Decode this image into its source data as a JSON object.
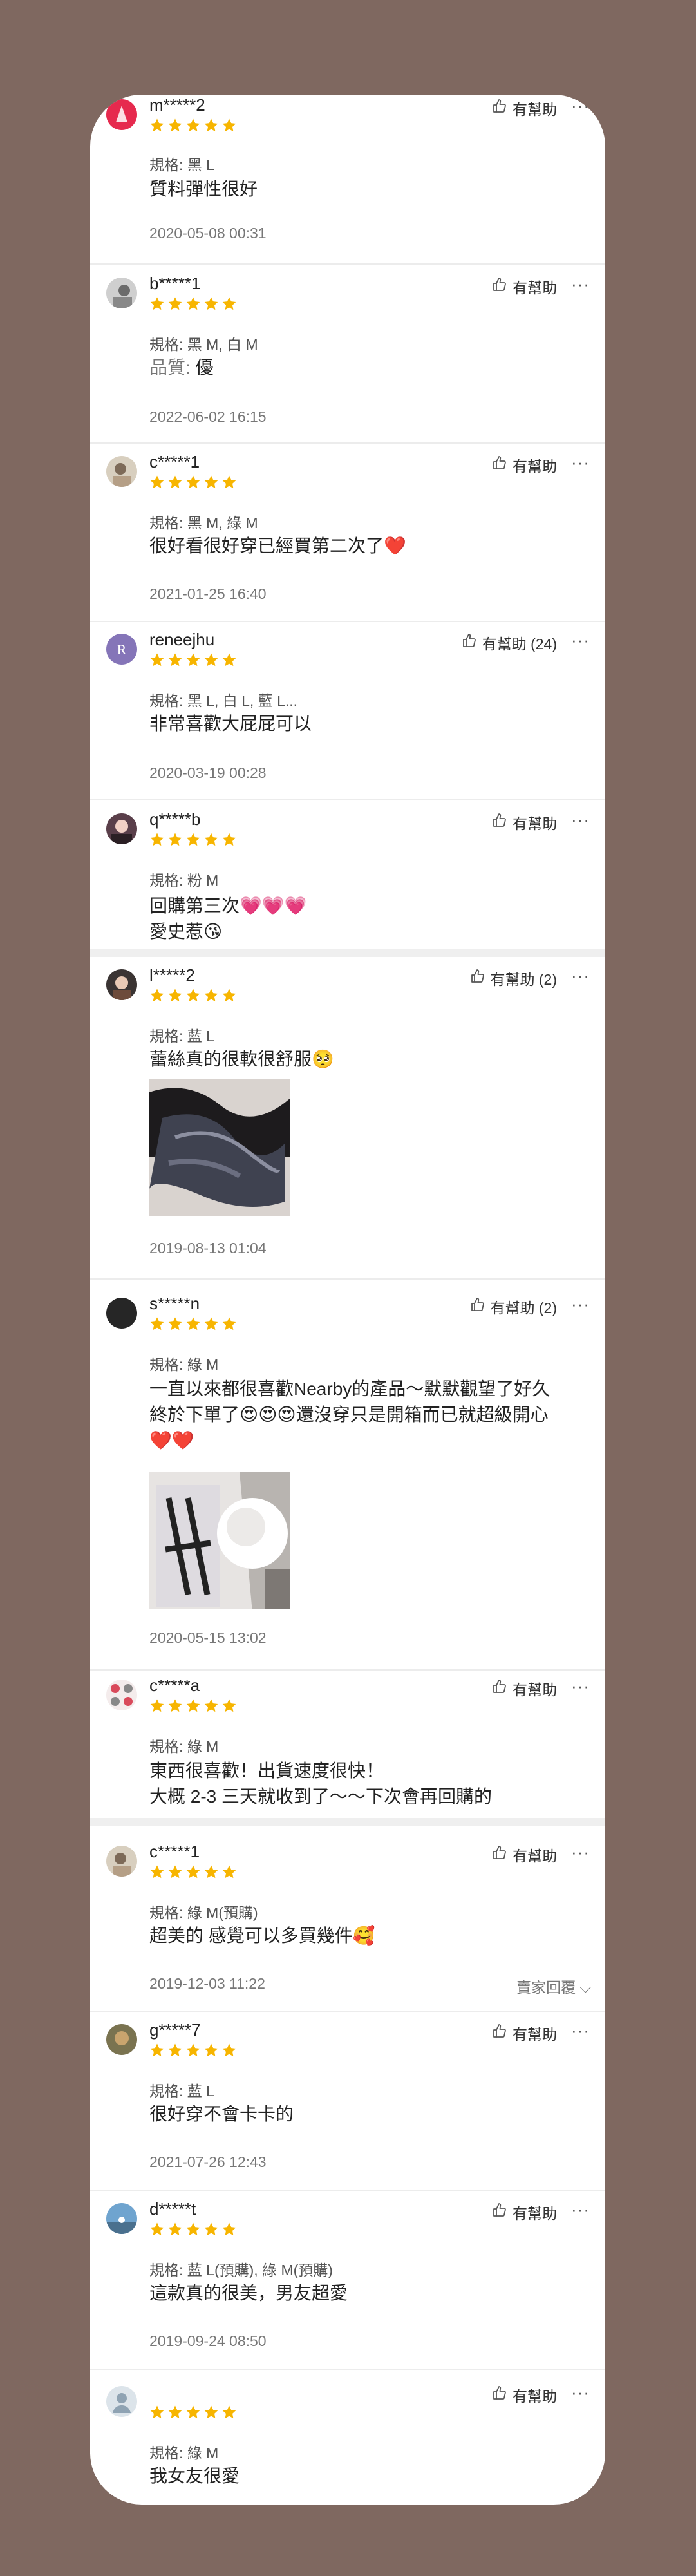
{
  "helpful_label": "有幫助",
  "more_label": "···",
  "seller_reply_label": "賣家回覆 ⌵",
  "reviews": [
    {
      "user": "m*****2",
      "spec": "規格: 黑 L",
      "text": "質料彈性很好",
      "date": "2020-05-08 00:31",
      "helpful": "有幫助",
      "rating": 5
    },
    {
      "user": "b*****1",
      "spec": "規格: 黑 M, 白 M",
      "text_label": "品質:",
      "text_value": "優",
      "date": "2022-06-02 16:15",
      "helpful": "有幫助",
      "rating": 5
    },
    {
      "user": "c*****1",
      "spec": "規格: 黑 M, 綠 M",
      "text": "很好看很好穿已經買第二次了❤️",
      "date": "2021-01-25 16:40",
      "helpful": "有幫助",
      "rating": 5
    },
    {
      "user": "reneejhu",
      "spec": "規格: 黑 L, 白 L, 藍 L...",
      "text": "非常喜歡大屁屁可以",
      "date": "2020-03-19 00:28",
      "helpful": "有幫助 (24)",
      "rating": 5
    },
    {
      "user": "q*****b",
      "spec": "規格: 粉 M",
      "text_line1": "回購第三次💗💗💗",
      "text_line2": "愛史惹😘",
      "helpful": "有幫助",
      "rating": 5
    },
    {
      "user": "l*****2",
      "spec": "規格: 藍 L",
      "text": "蕾絲真的很軟很舒服🥺",
      "date": "2019-08-13 01:04",
      "helpful": "有幫助 (2)",
      "rating": 5
    },
    {
      "user": "s*****n",
      "spec": "規格: 綠 M",
      "text_line1": "一直以來都很喜歡Nearby的產品～默默觀望了好久",
      "text_line2": "終於下單了😍😍😍還沒穿只是開箱而已就超級開心",
      "text_line3": "❤️❤️",
      "date": "2020-05-15 13:02",
      "helpful": "有幫助 (2)",
      "rating": 5
    },
    {
      "user": "c*****a",
      "spec": "規格: 綠 M",
      "text_line1": "東西很喜歡！出貨速度很快！",
      "text_line2": "大概 2-3 三天就收到了～～下次會再回購的",
      "helpful": "有幫助",
      "rating": 5
    },
    {
      "user": "c*****1",
      "spec": "規格: 綠 M(預購)",
      "text": "超美的 感覺可以多買幾件🥰",
      "date": "2019-12-03 11:22",
      "helpful": "有幫助",
      "rating": 5
    },
    {
      "user": "g*****7",
      "spec": "規格: 藍 L",
      "text": "很好穿不會卡卡的",
      "date": "2021-07-26 12:43",
      "helpful": "有幫助",
      "rating": 5
    },
    {
      "user": "d*****t",
      "spec": "規格: 藍 L(預購), 綠 M(預購)",
      "text": "這款真的很美，男友超愛",
      "date": "2019-09-24 08:50",
      "helpful": "有幫助",
      "rating": 5
    },
    {
      "user": "",
      "spec": "規格: 綠 M",
      "text": "我女友很愛",
      "helpful": "有幫助",
      "rating": 5
    }
  ],
  "colors": {
    "background": "#7f6860",
    "card": "#ffffff",
    "star": "#f7b500",
    "muted": "#777777"
  }
}
